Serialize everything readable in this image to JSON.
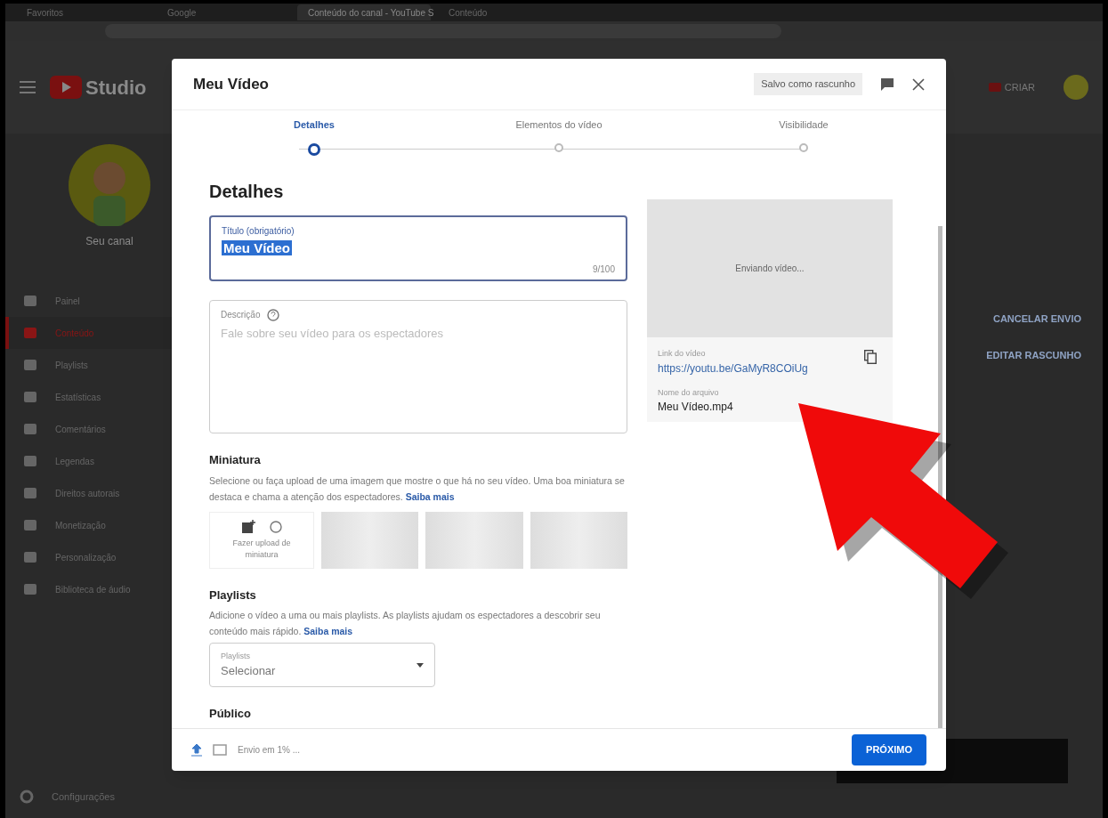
{
  "browser": {
    "tabs": [
      {
        "label": "Favoritos",
        "selected": false
      },
      {
        "label": "Google",
        "selected": false
      },
      {
        "label": "Conteúdo do canal - YouTube S",
        "selected": true
      },
      {
        "label": "Conteúdo",
        "selected": false
      }
    ]
  },
  "app_header": {
    "logo_text": "Studio",
    "create_button": "CRIAR"
  },
  "sidebar": {
    "channel_name": "Seu canal",
    "items": [
      {
        "label": "Painel",
        "selected": false
      },
      {
        "label": "Conteúdo",
        "selected": true
      },
      {
        "label": "Playlists",
        "selected": false
      },
      {
        "label": "Estatísticas",
        "selected": false
      },
      {
        "label": "Comentários",
        "selected": false
      },
      {
        "label": "Legendas",
        "selected": false
      },
      {
        "label": "Direitos autorais",
        "selected": false
      },
      {
        "label": "Monetização",
        "selected": false
      },
      {
        "label": "Personalização",
        "selected": false
      },
      {
        "label": "Biblioteca de áudio",
        "selected": false
      }
    ],
    "settings": "Configurações"
  },
  "background": {
    "actions": [
      "CANCELAR ENVIO",
      "EDITAR RASCUNHO"
    ]
  },
  "modal": {
    "title": "Meu Vídeo",
    "saved_badge": "Salvo como rascunho",
    "steps": [
      {
        "label": "Detalhes",
        "selected": true
      },
      {
        "label": "Elementos do vídeo",
        "selected": false
      },
      {
        "label": "Visibilidade",
        "selected": false
      }
    ],
    "heading": "Detalhes",
    "title_field": {
      "label": "Título (obrigatório)",
      "value": "Meu Vídeo",
      "value_selected": true,
      "counter": "9/100"
    },
    "description_field": {
      "label": "Descrição",
      "placeholder": "Fale sobre seu vídeo para os espectadores"
    },
    "thumbnail": {
      "heading": "Miniatura",
      "text": "Selecione ou faça upload de uma imagem que mostre o que há no seu vídeo. Uma boa miniatura se destaca e chama a atenção dos espectadores.",
      "link": "Saiba mais",
      "upload_label": "Fazer upload de miniatura"
    },
    "playlists": {
      "heading": "Playlists",
      "text": "Adicione o vídeo a uma ou mais playlists. As playlists ajudam os espectadores a descobrir seu conteúdo mais rápido.",
      "link": "Saiba mais",
      "select_label": "Playlists",
      "select_value": "Selecionar"
    },
    "audience": {
      "heading": "Público"
    },
    "preview": {
      "status": "Enviando vídeo...",
      "link_label": "Link do vídeo",
      "link": "https://youtu.be/GaMyR8COiUg",
      "filename_label": "Nome do arquivo",
      "filename": "Meu Vídeo.mp4"
    },
    "footer": {
      "status": "Envio em 1% ...",
      "next_button": "PRÓXIMO"
    }
  }
}
